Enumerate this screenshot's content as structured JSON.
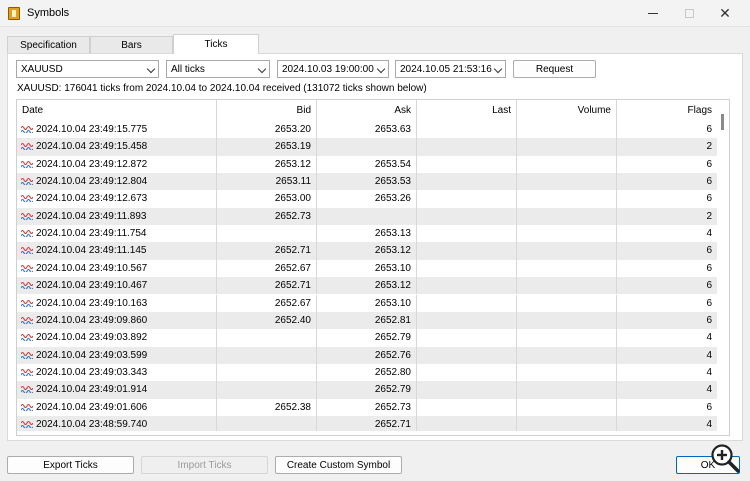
{
  "window": {
    "title": "Symbols",
    "buttons": {
      "close": "✕"
    }
  },
  "tabs": [
    {
      "label": "Specification",
      "active": false
    },
    {
      "label": "Bars",
      "active": false
    },
    {
      "label": "Ticks",
      "active": true
    }
  ],
  "toolbar": {
    "symbol": "XAUUSD",
    "tick_type": "All ticks",
    "date_from": "2024.10.03 19:00:00",
    "date_to": "2024.10.05 21:53:16",
    "request_label": "Request"
  },
  "status_text": "XAUUSD: 176041 ticks from 2024.10.04 to 2024.10.04 received (131072 ticks shown below)",
  "table": {
    "columns": [
      "Date",
      "Bid",
      "Ask",
      "Last",
      "Volume",
      "Flags"
    ],
    "rows": [
      {
        "date": "2024.10.04 23:49:15.775",
        "bid": "2653.20",
        "ask": "2653.63",
        "last": "",
        "volume": "",
        "flags": "6"
      },
      {
        "date": "2024.10.04 23:49:15.458",
        "bid": "2653.19",
        "ask": "",
        "last": "",
        "volume": "",
        "flags": "2"
      },
      {
        "date": "2024.10.04 23:49:12.872",
        "bid": "2653.12",
        "ask": "2653.54",
        "last": "",
        "volume": "",
        "flags": "6"
      },
      {
        "date": "2024.10.04 23:49:12.804",
        "bid": "2653.11",
        "ask": "2653.53",
        "last": "",
        "volume": "",
        "flags": "6"
      },
      {
        "date": "2024.10.04 23:49:12.673",
        "bid": "2653.00",
        "ask": "2653.26",
        "last": "",
        "volume": "",
        "flags": "6"
      },
      {
        "date": "2024.10.04 23:49:11.893",
        "bid": "2652.73",
        "ask": "",
        "last": "",
        "volume": "",
        "flags": "2"
      },
      {
        "date": "2024.10.04 23:49:11.754",
        "bid": "",
        "ask": "2653.13",
        "last": "",
        "volume": "",
        "flags": "4"
      },
      {
        "date": "2024.10.04 23:49:11.145",
        "bid": "2652.71",
        "ask": "2653.12",
        "last": "",
        "volume": "",
        "flags": "6"
      },
      {
        "date": "2024.10.04 23:49:10.567",
        "bid": "2652.67",
        "ask": "2653.10",
        "last": "",
        "volume": "",
        "flags": "6"
      },
      {
        "date": "2024.10.04 23:49:10.467",
        "bid": "2652.71",
        "ask": "2653.12",
        "last": "",
        "volume": "",
        "flags": "6"
      },
      {
        "date": "2024.10.04 23:49:10.163",
        "bid": "2652.67",
        "ask": "2653.10",
        "last": "",
        "volume": "",
        "flags": "6"
      },
      {
        "date": "2024.10.04 23:49:09.860",
        "bid": "2652.40",
        "ask": "2652.81",
        "last": "",
        "volume": "",
        "flags": "6"
      },
      {
        "date": "2024.10.04 23:49:03.892",
        "bid": "",
        "ask": "2652.79",
        "last": "",
        "volume": "",
        "flags": "4"
      },
      {
        "date": "2024.10.04 23:49:03.599",
        "bid": "",
        "ask": "2652.76",
        "last": "",
        "volume": "",
        "flags": "4"
      },
      {
        "date": "2024.10.04 23:49:03.343",
        "bid": "",
        "ask": "2652.80",
        "last": "",
        "volume": "",
        "flags": "4"
      },
      {
        "date": "2024.10.04 23:49:01.914",
        "bid": "",
        "ask": "2652.79",
        "last": "",
        "volume": "",
        "flags": "4"
      },
      {
        "date": "2024.10.04 23:49:01.606",
        "bid": "2652.38",
        "ask": "2652.73",
        "last": "",
        "volume": "",
        "flags": "6"
      },
      {
        "date": "2024.10.04 23:48:59.740",
        "bid": "",
        "ask": "2652.71",
        "last": "",
        "volume": "",
        "flags": "4"
      }
    ]
  },
  "footer": {
    "export_label": "Export Ticks",
    "import_label": "Import Ticks",
    "custom_label": "Create Custom Symbol",
    "ok_label": "OK"
  },
  "icons": {
    "tick_row": "tick-wave-icon",
    "app": "app-icon",
    "zoom": "zoom-in-icon"
  },
  "colors": {
    "tick_icon_red": "#d04040",
    "tick_icon_blue": "#3070d0",
    "ok_border": "#0067c0"
  }
}
